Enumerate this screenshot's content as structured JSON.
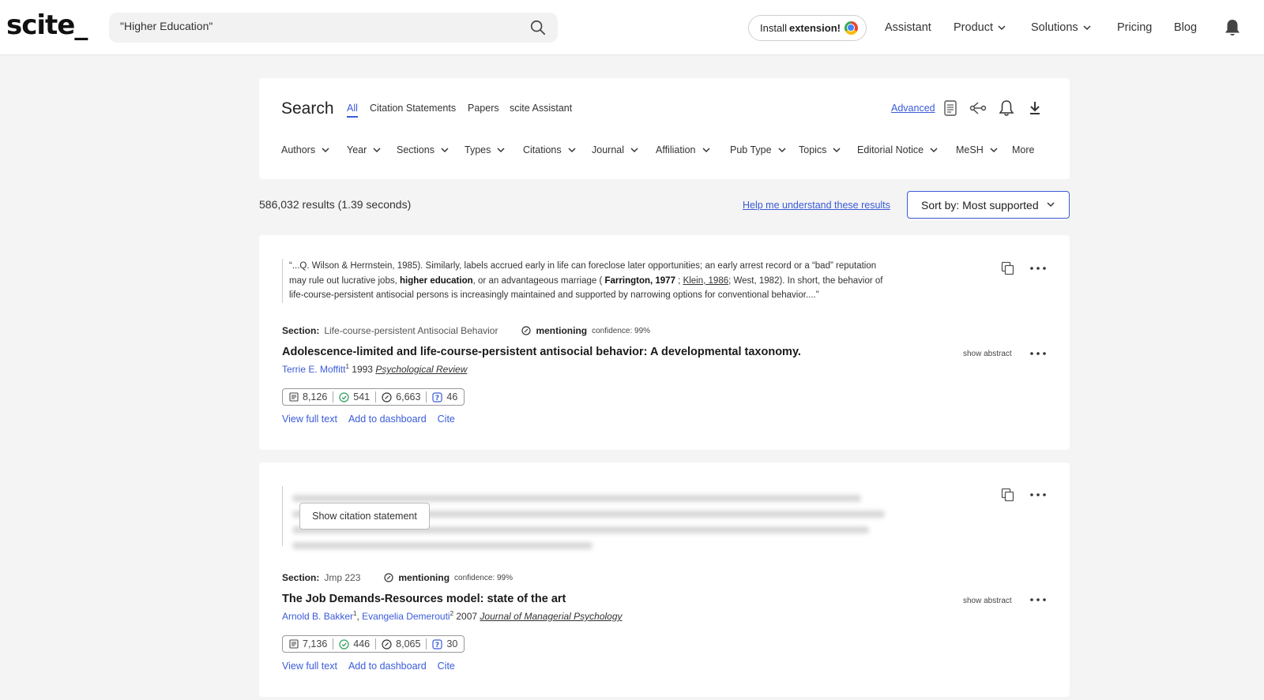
{
  "header": {
    "logo": "scite_",
    "search_value": "\"Higher Education\"",
    "install_prefix": "Install ",
    "install_bold": "extension!",
    "nav": [
      "Assistant",
      "Product",
      "Solutions",
      "Pricing",
      "Blog"
    ]
  },
  "search_panel": {
    "title": "Search",
    "tabs": [
      "All",
      "Citation Statements",
      "Papers",
      "scite Assistant"
    ],
    "advanced": "Advanced",
    "filters": [
      "Authors",
      "Year",
      "Sections",
      "Types",
      "Citations",
      "Journal",
      "Affiliation",
      "Pub Type",
      "Topics",
      "Editorial Notice",
      "MeSH",
      "More"
    ]
  },
  "results": {
    "count": "586,032 results (1.39 seconds)",
    "help": "Help me understand these results",
    "sort": "Sort by: Most supported"
  },
  "cards": [
    {
      "quote_1": "“...Q. Wilson & Herrnstein, 1985). Similarly, labels accrued early in life can foreclose later opportunities; an early arrest record or a “bad” reputation may rule out lucrative jobs, ",
      "quote_bold": "higher education",
      "quote_2": ", or an advantageous marriage ( ",
      "quote_ref_bold": "Farrington, 1977",
      "quote_3": " ; ",
      "quote_ref_u": "Klein, 1986",
      "quote_4": "; West, 1982). In short, the behavior of life-course-persistent antisocial persons is increasingly maintained and supported by narrowing options for conventional behavior....”",
      "section_label": "Section:",
      "section_value": "Life-course-persistent Antisocial Behavior",
      "tag": "mentioning",
      "confidence": "confidence: 99%",
      "title": "Adolescence-limited and life-course-persistent antisocial behavior: A developmental taxonomy.",
      "author_1": "Terrie E. Moffitt",
      "author_1_sup": "1",
      "year": "1993",
      "journal": "Psychological Review",
      "stats": [
        "8,126",
        "541",
        "6,663",
        "46"
      ],
      "links": [
        "View full text",
        "Add to dashboard",
        "Cite"
      ],
      "show_abstract": "show abstract"
    },
    {
      "show_citation": "Show citation statement",
      "section_label": "Section:",
      "section_value": "Jmp 223",
      "tag": "mentioning",
      "confidence": "confidence: 99%",
      "title": "The Job Demands-Resources model: state of the art",
      "author_1": "Arnold B. Bakker",
      "author_1_sup": "1",
      "author_2": "Evangelia Demerouti",
      "author_2_sup": "2",
      "year": "2007",
      "journal": "Journal of Managerial Psychology",
      "stats": [
        "7,136",
        "446",
        "8,065",
        "30"
      ],
      "links": [
        "View full text",
        "Add to dashboard",
        "Cite"
      ],
      "show_abstract": "show abstract"
    }
  ]
}
